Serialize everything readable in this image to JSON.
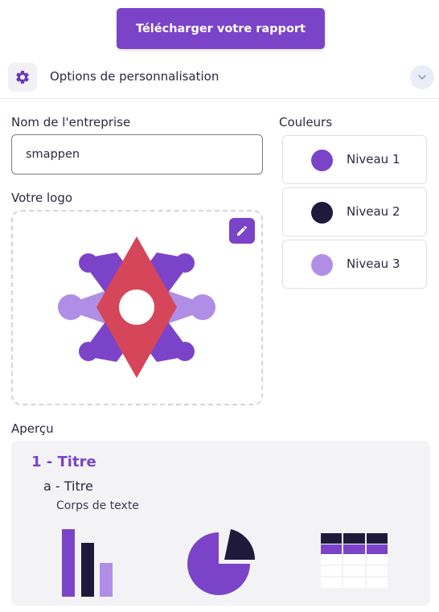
{
  "download_button": {
    "label": "Télécharger votre rapport"
  },
  "options_header": {
    "title": "Options de personnalisation",
    "icon": "gear-icon",
    "toggle_icon": "chevron-down-icon"
  },
  "company": {
    "label": "Nom de l'entreprise",
    "value": "smappen"
  },
  "logo": {
    "label": "Votre logo",
    "edit_icon": "pencil-icon"
  },
  "colors": {
    "label": "Couleurs",
    "levels": [
      {
        "name": "Niveau 1",
        "color": "#7b44c8"
      },
      {
        "name": "Niveau 2",
        "color": "#1f1a3c"
      },
      {
        "name": "Niveau 3",
        "color": "#b18ee6"
      }
    ]
  },
  "preview": {
    "label": "Aperçu",
    "heading1": "1 - Titre",
    "heading2": "a - Titre",
    "body_text": "Corps de texte"
  },
  "brand_colors": {
    "primary": "#7b44c8",
    "dark": "#1f1a3c",
    "light": "#b18ee6",
    "logo_accent": "#d5465a"
  }
}
